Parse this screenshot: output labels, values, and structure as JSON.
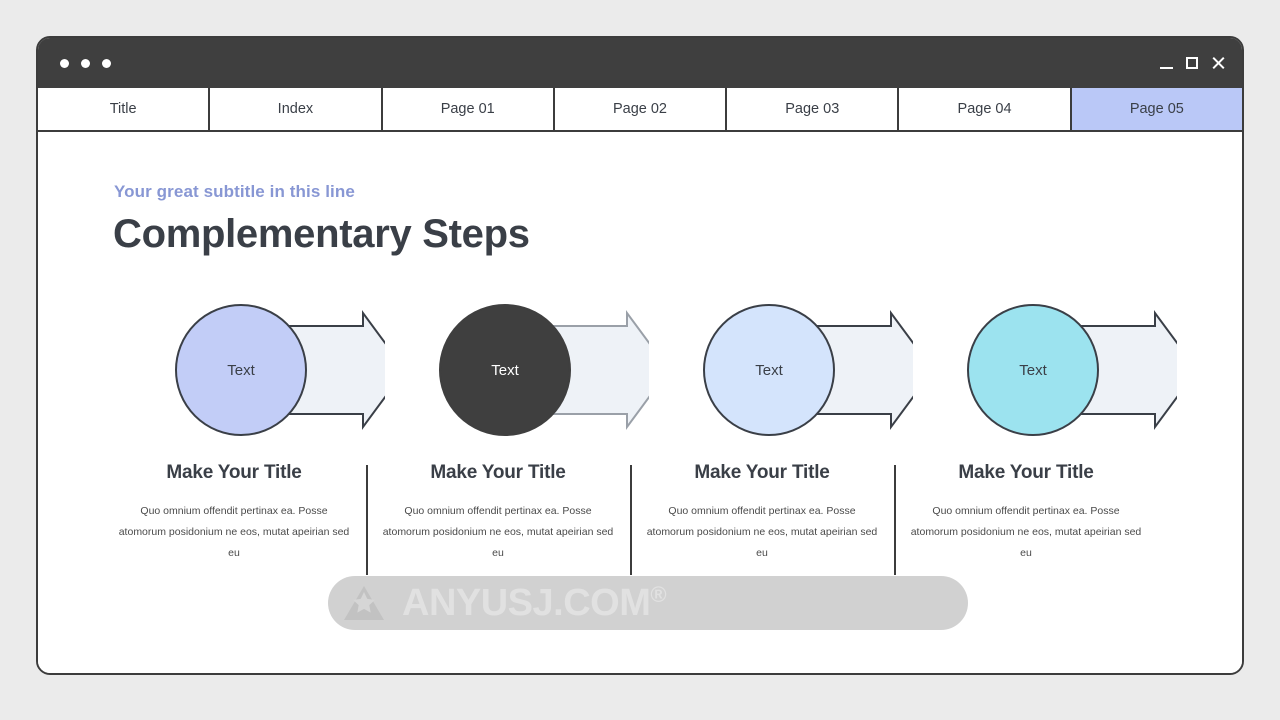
{
  "window": {
    "dots_count": 3,
    "controls": {
      "minimize": "minimize",
      "maximize": "maximize",
      "close": "close"
    }
  },
  "tabs": [
    {
      "label": "Title",
      "active": false
    },
    {
      "label": "Index",
      "active": false
    },
    {
      "label": "Page 01",
      "active": false
    },
    {
      "label": "Page 02",
      "active": false
    },
    {
      "label": "Page 03",
      "active": false
    },
    {
      "label": "Page 04",
      "active": false
    },
    {
      "label": "Page 05",
      "active": true
    }
  ],
  "slide": {
    "subtitle": "Your great subtitle in this line",
    "title": "Complementary Steps",
    "steps": [
      {
        "circle_text": "Text",
        "circle_color": "#c2cdf7",
        "text_on_dark": false,
        "caption_title": "Make Your Title",
        "caption_body": "Quo omnium offendit pertinax ea. Posse atomorum posidonium ne eos, mutat apeirian sed eu"
      },
      {
        "circle_text": "Text",
        "circle_color": "#3f3f3f",
        "text_on_dark": true,
        "caption_title": "Make Your Title",
        "caption_body": "Quo omnium offendit pertinax ea. Posse atomorum posidonium ne eos, mutat apeirian sed eu"
      },
      {
        "circle_text": "Text",
        "circle_color": "#d4e4fc",
        "text_on_dark": false,
        "caption_title": "Make Your Title",
        "caption_body": "Quo omnium offendit pertinax ea. Posse atomorum posidonium ne eos, mutat apeirian sed eu"
      },
      {
        "circle_text": "Text",
        "circle_color": "#9ce3ef",
        "text_on_dark": false,
        "caption_title": "Make Your Title",
        "caption_body": "Quo omnium offendit pertinax ea. Posse atomorum posidonium ne eos, mutat apeirian sed eu"
      }
    ],
    "arrow_fill": "#eef2f7",
    "arrow_stroke": "#3a3f47"
  },
  "watermark": {
    "text": "ANYUSJ.COM",
    "registered_mark": "®"
  },
  "colors": {
    "page_background": "#ebebeb",
    "titlebar": "#3f3f3f",
    "active_tab": "#bac8f7",
    "subtitle": "#8897d4",
    "heading": "#3a3f47",
    "border": "#3c3c3c"
  }
}
